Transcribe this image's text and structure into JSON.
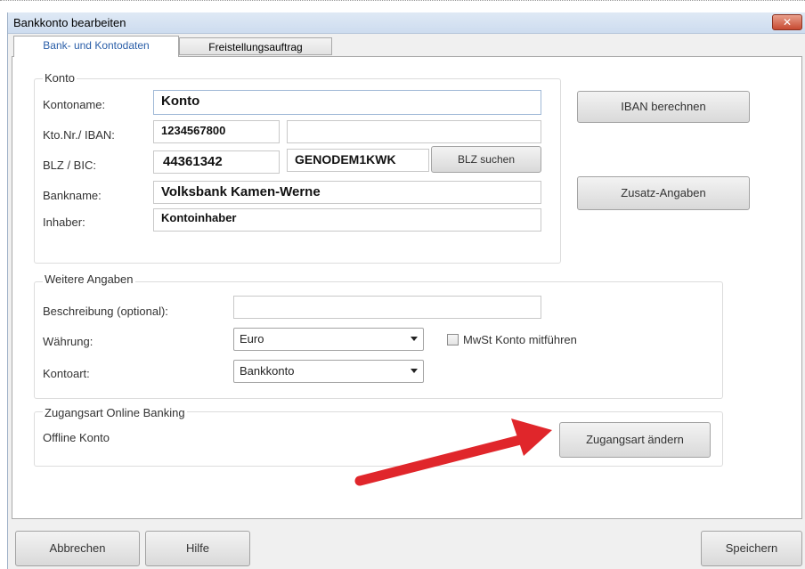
{
  "window": {
    "title": "Bankkonto bearbeiten",
    "close_glyph": "✕"
  },
  "tabs": [
    {
      "label": "Bank- und Kontodaten",
      "active": true
    },
    {
      "label": "Freistellungsauftrag",
      "active": false
    }
  ],
  "konto": {
    "group_title": "Konto",
    "kontoname_label": "Kontoname:",
    "kontoname_value": "Konto",
    "ktonr_label": "Kto.Nr./ IBAN:",
    "ktonr_value": "1234567800",
    "iban_value": "",
    "blz_label": "BLZ / BIC:",
    "blz_value": "44361342",
    "bic_value": "GENODEM1KWK",
    "blz_suchen": "BLZ suchen",
    "bankname_label": "Bankname:",
    "bankname_value": "Volksbank Kamen-Werne",
    "inhaber_label": "Inhaber:",
    "inhaber_value": "Kontoinhaber"
  },
  "side_buttons": {
    "iban_berechnen": "IBAN berechnen",
    "zusatz_angaben": "Zusatz-Angaben"
  },
  "weitere": {
    "group_title": "Weitere Angaben",
    "beschreibung_label": "Beschreibung (optional):",
    "beschreibung_value": "",
    "waehrung_label": "Währung:",
    "waehrung_value": "Euro",
    "mwst_label": "MwSt Konto mitführen",
    "mwst_checked": false,
    "kontoart_label": "Kontoart:",
    "kontoart_value": "Bankkonto"
  },
  "zugang": {
    "group_title": "Zugangsart Online Banking",
    "status": "Offline Konto",
    "aendern_button": "Zugangsart ändern"
  },
  "footer": {
    "abbrechen": "Abbrechen",
    "hilfe": "Hilfe",
    "speichern": "Speichern"
  },
  "colors": {
    "annotation_arrow": "#e0262b",
    "active_tab_text": "#2a5ea8"
  },
  "icons": {
    "arrow": "red-annotation-arrow-icon",
    "close": "close-icon",
    "caret": "chevron-down-icon"
  }
}
